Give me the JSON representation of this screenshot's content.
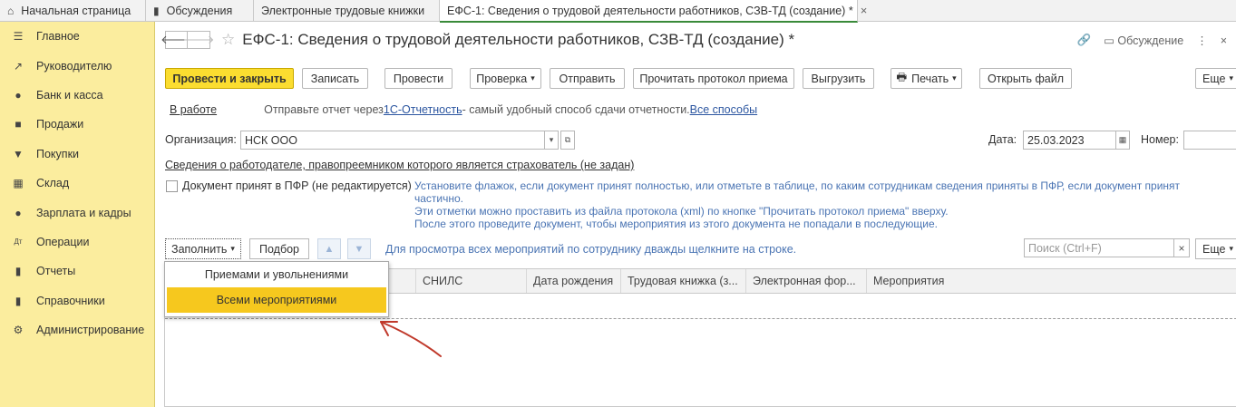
{
  "tabs": [
    {
      "label": "Начальная страница",
      "icon": "home-icon"
    },
    {
      "label": "Обсуждения",
      "icon": "chat-icon"
    },
    {
      "label": "Электронные трудовые книжки"
    },
    {
      "label": "ЕФС-1: Сведения о трудовой деятельности работников, СЗВ-ТД (создание) *",
      "active": true
    }
  ],
  "sidebar": {
    "items": [
      {
        "label": "Главное",
        "icon": "menu-icon"
      },
      {
        "label": "Руководителю",
        "icon": "trend-icon"
      },
      {
        "label": "Банк и касса",
        "icon": "coin-icon"
      },
      {
        "label": "Продажи",
        "icon": "bag-icon"
      },
      {
        "label": "Покупки",
        "icon": "cart-icon"
      },
      {
        "label": "Склад",
        "icon": "grid-icon"
      },
      {
        "label": "Зарплата и кадры",
        "icon": "person-icon"
      },
      {
        "label": "Операции",
        "icon": "dt-kt-icon"
      },
      {
        "label": "Отчеты",
        "icon": "bar-chart-icon"
      },
      {
        "label": "Справочники",
        "icon": "book-icon"
      },
      {
        "label": "Администрирование",
        "icon": "gear-icon"
      }
    ]
  },
  "header": {
    "title": "ЕФС-1: Сведения о трудовой деятельности работников, СЗВ-ТД (создание) *",
    "discussion": "Обсуждение"
  },
  "toolbar": {
    "post_close": "Провести и закрыть",
    "save": "Записать",
    "post": "Провести",
    "check": "Проверка",
    "send": "Отправить",
    "read_protocol": "Прочитать протокол приема",
    "upload": "Выгрузить",
    "print": "Печать",
    "open_file": "Открыть файл",
    "more": "Еще"
  },
  "status": {
    "state": "В работе",
    "text1": "Отправьте отчет через ",
    "link1": "1С-Отчетность",
    "text2": " - самый удобный способ сдачи отчетности. ",
    "link2": "Все способы"
  },
  "form": {
    "org_label": "Организация:",
    "org_value": "НСК ООО",
    "date_label": "Дата:",
    "date_value": "25.03.2023",
    "number_label": "Номер:",
    "employer_link": "Сведения о работодателе, правопреемником которого является страхователь (не задан)",
    "accepted_label": "Документ принят в ПФР (не редактируется)",
    "hint_lines": [
      "Установите флажок, если документ принят полностью, или отметьте в таблице, по каким сотрудникам сведения приняты в ПФР, если документ принят",
      "частично.",
      "Эти отметки можно проставить из файла протокола (xml) по кнопке \"Прочитать протокол приема\" вверху.",
      "После этого проведите документ, чтобы мероприятия из этого документа не попадали в последующие."
    ]
  },
  "table_toolbar": {
    "fill": "Заполнить",
    "select": "Подбор",
    "hint": "Для просмотра всех мероприятий по сотруднику дважды щелкните на строке.",
    "search_placeholder": "Поиск (Ctrl+F)",
    "more": "Еще"
  },
  "table": {
    "columns": [
      "СНИЛС",
      "Дата рождения",
      "Трудовая книжка (з...",
      "Электронная фор...",
      "Мероприятия"
    ]
  },
  "popup": {
    "items": [
      "Приемами и увольнениями",
      "Всеми мероприятиями"
    ],
    "selected": 1
  },
  "colors": {
    "sidebar_bg": "#fbed9e",
    "primary_button": "#fbdd30",
    "selected_item": "#f6c81e",
    "link_blue": "#2c56a0",
    "link_green": "#3b8a3b",
    "annotation_arrow": "#c0392b"
  }
}
